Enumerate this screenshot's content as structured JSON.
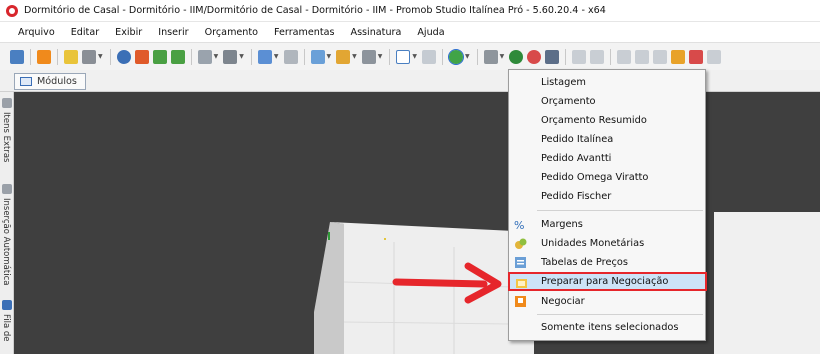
{
  "window": {
    "title": "Dormitório de Casal - Dormitório - IIM/Dormitório de Casal - Dormitório - IIM - Promob Studio Italínea Pró - 5.60.20.4 - x64"
  },
  "menubar": {
    "items": [
      "Arquivo",
      "Editar",
      "Exibir",
      "Inserir",
      "Orçamento",
      "Ferramentas",
      "Assinatura",
      "Ajuda"
    ]
  },
  "tabs": {
    "modulos": "Módulos"
  },
  "sidebar": {
    "labels": [
      "Itens Extras",
      "Inserção Automática",
      "Fila de"
    ]
  },
  "dropdown": {
    "group1": [
      "Listagem",
      "Orçamento",
      "Orçamento Resumido",
      "Pedido Italínea",
      "Pedido Avantti",
      "Pedido Omega Viratto",
      "Pedido Fischer"
    ],
    "group2": [
      {
        "label": "Margens",
        "icon": "percent-icon"
      },
      {
        "label": "Unidades Monetárias",
        "icon": "coins-icon"
      },
      {
        "label": "Tabelas de Preços",
        "icon": "price-table-icon"
      },
      {
        "label": "Preparar para Negociação",
        "icon": "folder-prepare-icon"
      },
      {
        "label": "Negociar",
        "icon": "negotiate-icon"
      }
    ],
    "group3": [
      "Somente itens selecionados"
    ]
  },
  "colors": {
    "highlight_border": "#e6262b",
    "highlight_fill": "#cde3f7",
    "arrow": "#e6262b",
    "viewport": "#3f3f3f"
  }
}
